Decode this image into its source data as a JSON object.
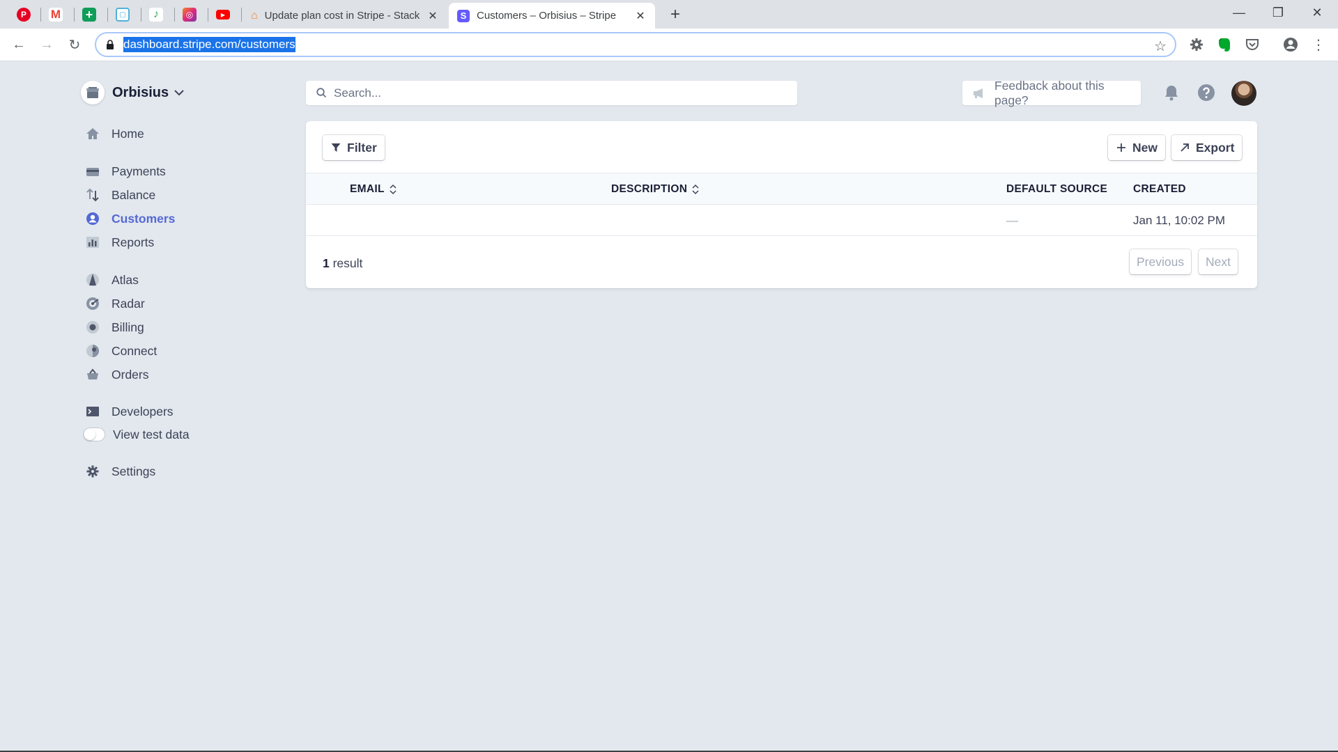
{
  "browser": {
    "pinned_tabs": [
      {
        "icon": "pinterest-icon",
        "color": "#e60023",
        "glyph": "P"
      },
      {
        "icon": "gmail-icon",
        "color": "#ea4335",
        "glyph": "M"
      },
      {
        "icon": "sheets-icon",
        "color": "#0f9d58",
        "glyph": "+"
      },
      {
        "icon": "app-icon",
        "color": "#4fb3d9",
        "glyph": "▢"
      },
      {
        "icon": "app-icon-green",
        "color": "#34a853",
        "glyph": "♪"
      },
      {
        "icon": "app-icon-purple",
        "color": "#c13584",
        "glyph": "◎"
      },
      {
        "icon": "youtube-icon",
        "color": "#ff0000",
        "glyph": "▶"
      }
    ],
    "tabs": [
      {
        "title": "Update plan cost in Stripe - Stack",
        "active": false
      },
      {
        "title": "Customers – Orbisius – Stripe",
        "active": true
      }
    ],
    "url": "dashboard.stripe.com/customers"
  },
  "account": {
    "name": "Orbisius"
  },
  "nav": {
    "home": "Home",
    "payments": "Payments",
    "balance": "Balance",
    "customers": "Customers",
    "reports": "Reports",
    "atlas": "Atlas",
    "radar": "Radar",
    "billing": "Billing",
    "connect": "Connect",
    "orders": "Orders",
    "developers": "Developers",
    "view_test_data": "View test data",
    "settings": "Settings"
  },
  "topbar": {
    "search_placeholder": "Search...",
    "feedback": "Feedback about this page?"
  },
  "card": {
    "filter_label": "Filter",
    "new_label": "New",
    "export_label": "Export",
    "columns": {
      "email": "EMAIL",
      "description": "DESCRIPTION",
      "default_source": "DEFAULT SOURCE",
      "created": "CREATED"
    },
    "rows": [
      {
        "email": "",
        "description": "",
        "default_source": "—",
        "created": "Jan 11, 10:02 PM"
      }
    ],
    "result_count": "1",
    "result_label": "result",
    "previous_label": "Previous",
    "next_label": "Next"
  },
  "colors": {
    "accent": "#5469d4",
    "background": "#e3e8ee"
  }
}
